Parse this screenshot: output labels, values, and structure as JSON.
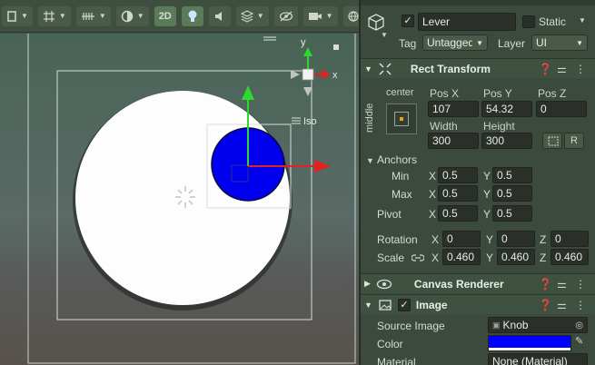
{
  "scene": {
    "toolbar": {
      "btn_2d": "2D"
    },
    "gizmo": {
      "y_label": "y",
      "x_label": "x",
      "iso_label": "Iso"
    }
  },
  "inspector": {
    "object": {
      "name": "Lever",
      "static_label": "Static",
      "tag_label": "Tag",
      "tag_value": "Untagged",
      "layer_label": "Layer",
      "layer_value": "UI"
    },
    "rect_transform": {
      "title": "Rect Transform",
      "anchor_preset_h": "center",
      "anchor_preset_v": "middle",
      "pos_x_label": "Pos X",
      "pos_y_label": "Pos Y",
      "pos_z_label": "Pos Z",
      "pos_x": "107",
      "pos_y": "54.32",
      "pos_z": "0",
      "width_label": "Width",
      "height_label": "Height",
      "width": "300",
      "height": "300",
      "r_button": "R",
      "anchors_label": "Anchors",
      "min_label": "Min",
      "max_label": "Max",
      "pivot_label": "Pivot",
      "x_label": "X",
      "y_label": "Y",
      "z_label": "Z",
      "min_x": "0.5",
      "min_y": "0.5",
      "max_x": "0.5",
      "max_y": "0.5",
      "pivot_x": "0.5",
      "pivot_y": "0.5",
      "rotation_label": "Rotation",
      "rot_x": "0",
      "rot_y": "0",
      "rot_z": "0",
      "scale_label": "Scale",
      "scale_x": "0.460",
      "scale_y": "0.460",
      "scale_z": "0.460"
    },
    "canvas_renderer": {
      "title": "Canvas Renderer"
    },
    "image": {
      "title": "Image",
      "source_image_label": "Source Image",
      "source_image_value": "Knob",
      "color_label": "Color",
      "color_value": "#0000ff",
      "material_label": "Material",
      "material_value": "None (Material)"
    }
  }
}
